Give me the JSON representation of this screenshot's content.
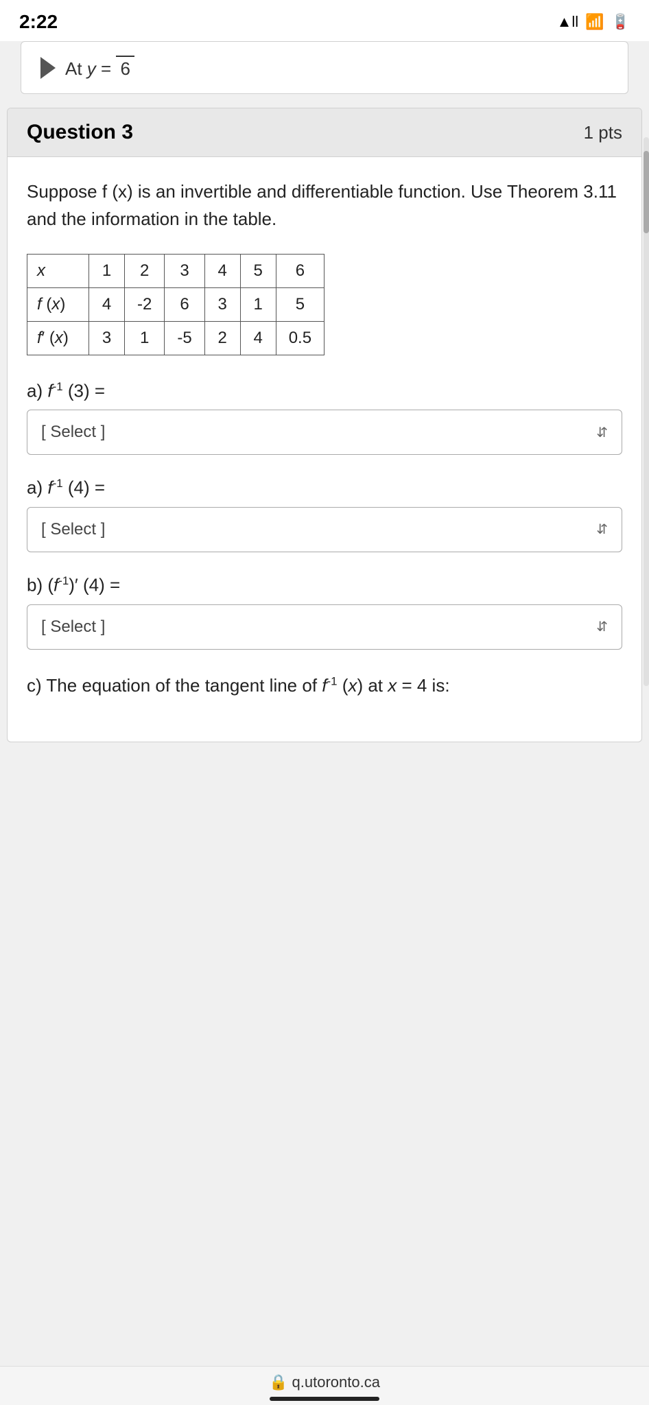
{
  "status_bar": {
    "time": "2:22",
    "signal": "▲ll",
    "wifi": "wifi",
    "battery": "battery"
  },
  "prev_question": {
    "text": "At y = —",
    "denominator": "6"
  },
  "question": {
    "title": "Question 3",
    "points": "1 pts",
    "body_text": "Suppose f (x) is an invertible and differentiable function. Use Theorem 3.11 and the information in the table.",
    "table": {
      "headers": [
        "x",
        "1",
        "2",
        "3",
        "4",
        "5",
        "6"
      ],
      "row_fx_label": "f (x)",
      "row_fx": [
        "4",
        "-2",
        "6",
        "3",
        "1",
        "5"
      ],
      "row_fpx_label": "f′ (x)",
      "row_fpx": [
        "3",
        "1",
        "-5",
        "2",
        "4",
        "0.5"
      ]
    },
    "sub_a1": {
      "label": "a) f⁻¹ (3) =",
      "select_placeholder": "[ Select ]"
    },
    "sub_a2": {
      "label": "a) f⁻¹ (4) =",
      "select_placeholder": "[ Select ]"
    },
    "sub_b": {
      "label": "b) (f⁻¹)′ (4) =",
      "select_placeholder": "[ Select ]"
    },
    "sub_c": {
      "label": "c) The equation of the tangent line of f⁻¹ (x) at x = 4 is:"
    }
  },
  "url_bar": {
    "text": "🔒 q.utoronto.ca"
  }
}
